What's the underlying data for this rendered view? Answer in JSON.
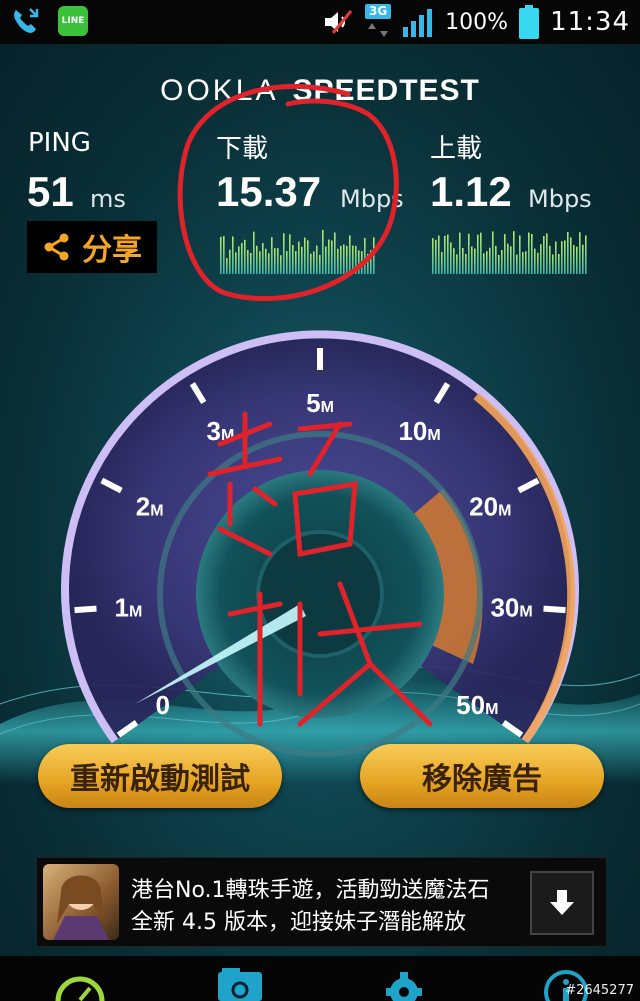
{
  "status_bar": {
    "network": "3G",
    "battery_percent": "100%",
    "clock": "11:34"
  },
  "app": {
    "logo_ookla": "OOKLA",
    "logo_speedtest": "SPEEDTEST"
  },
  "results": {
    "ping": {
      "label": "PING",
      "value": "51",
      "unit": "ms"
    },
    "download": {
      "label": "下載",
      "value": "15.37",
      "unit": "Mbps"
    },
    "upload": {
      "label": "上載",
      "value": "1.12",
      "unit": "Mbps"
    }
  },
  "share": {
    "label": "分享"
  },
  "gauge": {
    "ticks": [
      {
        "num": "0",
        "unit": ""
      },
      {
        "num": "1",
        "unit": "M"
      },
      {
        "num": "2",
        "unit": "M"
      },
      {
        "num": "3",
        "unit": "M"
      },
      {
        "num": "5",
        "unit": "M"
      },
      {
        "num": "10",
        "unit": "M"
      },
      {
        "num": "20",
        "unit": "M"
      },
      {
        "num": "30",
        "unit": "M"
      },
      {
        "num": "50",
        "unit": "M"
      }
    ],
    "needle_value_mbps": 0
  },
  "handwriting": {
    "text": "超快"
  },
  "buttons": {
    "restart_test": "重新啟動測試",
    "remove_ads": "移除廣告"
  },
  "ad": {
    "line1": "港台No.1轉珠手遊，活動勁送魔法石",
    "line2": "全新 4.5 版本，迎接妹子潛能解放"
  },
  "watermark": "#2645277",
  "colors": {
    "accent": "#f5a623",
    "button": "#e5a422",
    "background": "#0f4550",
    "gauge_ring": "#c9b8ff",
    "annotation": "#e0222a"
  }
}
